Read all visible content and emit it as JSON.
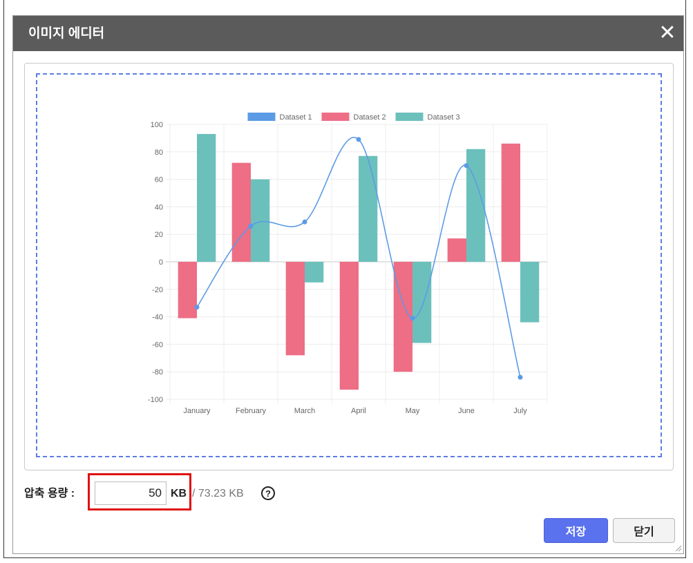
{
  "dialog": {
    "title": "이미지 에디터",
    "close_glyph": "✕"
  },
  "compress": {
    "label": "압축 용량 :",
    "value": "50",
    "unit": "KB",
    "total": "/ 73.23 KB",
    "help_glyph": "?"
  },
  "buttons": {
    "save": "저장",
    "close": "닫기"
  },
  "colors": {
    "title_bg": "#5b5b5b",
    "dataset1": "#5b9be6",
    "dataset2": "#ed6e85",
    "dataset3": "#6cc0bc",
    "save_button": "#5b72ee",
    "highlight": "#e01010",
    "crop_border": "#5b7de0"
  },
  "chart_data": {
    "type": "bar",
    "categories": [
      "January",
      "February",
      "March",
      "April",
      "May",
      "June",
      "July"
    ],
    "ylim": [
      -100,
      100
    ],
    "yticks": [
      100,
      80,
      60,
      40,
      20,
      0,
      -20,
      -40,
      -60,
      -80,
      -100
    ],
    "legend_position": "top",
    "grid": true,
    "series": [
      {
        "name": "Dataset 1",
        "type": "line",
        "smooth": true,
        "color": "#5b9be6",
        "values": [
          -33,
          26,
          29,
          89,
          -41,
          70,
          -84
        ]
      },
      {
        "name": "Dataset 2",
        "type": "bar",
        "color": "#ed6e85",
        "values": [
          -41,
          72,
          -68,
          -93,
          -80,
          17,
          86
        ]
      },
      {
        "name": "Dataset 3",
        "type": "bar",
        "color": "#6cc0bc",
        "values": [
          93,
          60,
          -15,
          77,
          -59,
          82,
          -44
        ]
      }
    ]
  }
}
